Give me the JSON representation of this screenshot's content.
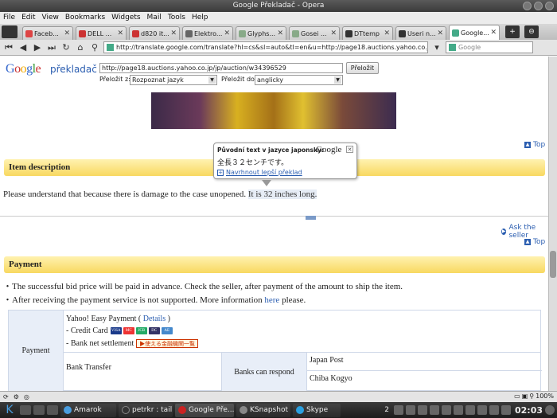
{
  "window": {
    "title": "Google Překladač - Opera"
  },
  "menu": [
    "File",
    "Edit",
    "View",
    "Bookmarks",
    "Widgets",
    "Mail",
    "Tools",
    "Help"
  ],
  "tabs": [
    {
      "label": "Faceb...",
      "color": "#d44"
    },
    {
      "label": "DELL ...",
      "color": "#c33"
    },
    {
      "label": "d820 it...",
      "color": "#c33"
    },
    {
      "label": "Elektro...",
      "color": "#666"
    },
    {
      "label": "Glyphs...",
      "color": "#8a8"
    },
    {
      "label": "Gosei ...",
      "color": "#8a8"
    },
    {
      "label": "DTtemp",
      "color": "#333"
    },
    {
      "label": "Useri n...",
      "color": "#333"
    },
    {
      "label": "Google...",
      "color": "#4a8"
    }
  ],
  "address": {
    "url": "http://translate.google.com/translate?hl=cs&sl=auto&tl=en&u=http://page18.auctions.yahoo.co.jp/jp/auc",
    "search_placeholder": "Google"
  },
  "gt": {
    "logo": "Google",
    "product": "překladač",
    "url_value": "http://page18.auctions.yahoo.co.jp/jp/auction/w34396529",
    "translate_btn": "Přeložit",
    "from_label": "Přeložit z:",
    "from_value": "Rozpoznat jazyk",
    "to_label": "Přeložit do:",
    "to_value": "anglicky"
  },
  "popup": {
    "title": "Původní text v jazyce japonsky:",
    "logo": "Google",
    "original": "全長３２センチです。",
    "suggest": "Navrhnout lepší překlad"
  },
  "page": {
    "top_link": "Top",
    "item_desc_header": "Item description",
    "item_desc_text": "Please understand that because there is damage to the case unopened.",
    "item_desc_highlight": "It is 32 inches long.",
    "ask_seller": "Ask the seller",
    "payment_header": "Payment",
    "payment_line1": "・The successful bid price will be paid in advance. Check the seller, after payment of the amount to ship the item.",
    "payment_line2_a": "・After receiving the payment service is not supported. More information",
    "payment_line2_link": "here",
    "payment_line2_b": "please.",
    "table": {
      "head": "Payment",
      "yahoo_easy": "Yahoo! Easy Payment (",
      "details": "Details",
      "close_paren": ")",
      "credit_card": "- Credit Card",
      "bank_settlement": "- Bank net settlement",
      "bank_badge": "▶使える金融機関一覧",
      "bank_transfer": "Bank Transfer",
      "banks_can_respond": "Banks can respond",
      "banks": [
        "Japan Post",
        "Chiba Kogyo"
      ]
    }
  },
  "status": {
    "zoom": "100%"
  },
  "taskbar": {
    "tasks": [
      {
        "label": "Amarok",
        "color": "#4a9ee0"
      },
      {
        "label": "petrkr : tail",
        "color": "#333"
      },
      {
        "label": "Google Pře...",
        "color": "#c22"
      },
      {
        "label": "KSnapshot",
        "color": "#888"
      },
      {
        "label": "Skype",
        "color": "#2aa0e0"
      }
    ],
    "desktop": "2",
    "clock": "02:03"
  }
}
